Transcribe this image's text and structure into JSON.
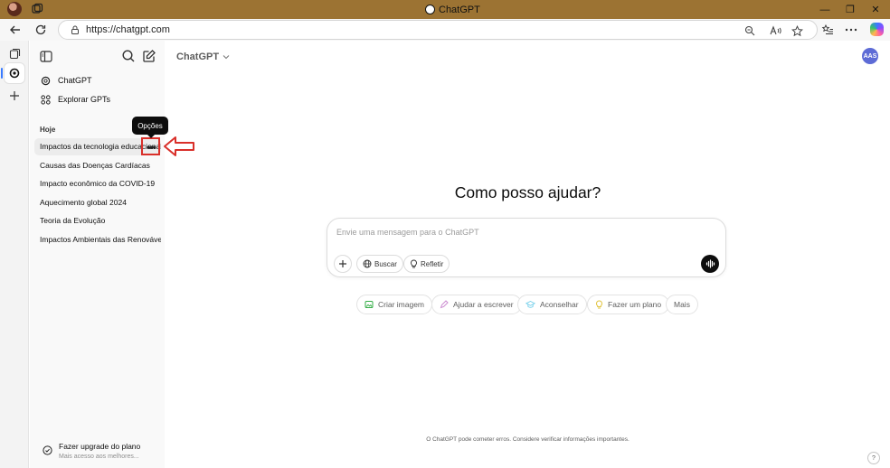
{
  "window": {
    "title": "ChatGPT"
  },
  "browser": {
    "url": "https://chatgpt.com",
    "window_controls": {
      "minimize": "—",
      "restore": "❐",
      "close": "✕"
    }
  },
  "sidebar": {
    "nav": [
      {
        "label": "ChatGPT",
        "icon": "chatgpt-logo-icon"
      },
      {
        "label": "Explorar GPTs",
        "icon": "grid-icon"
      }
    ],
    "section_label": "Hoje",
    "chats": [
      "Impactos da tecnologia educacional",
      "Causas das Doenças Cardíacas",
      "Impacto econômico da COVID-19",
      "Aquecimento global 2024",
      "Teoria da Evolução",
      "Impactos Ambientais das Renováveis"
    ],
    "options_tooltip": "Opções",
    "options_glyph": "•••",
    "upgrade": {
      "title": "Fazer upgrade do plano",
      "subtitle": "Mais acesso aos melhores..."
    }
  },
  "main": {
    "model": "ChatGPT",
    "avatar_initials": "AAS",
    "heading": "Como posso ajudar?",
    "composer": {
      "placeholder": "Envie uma mensagem para o ChatGPT",
      "buttons": {
        "search": "Buscar",
        "reason": "Refletir"
      }
    },
    "suggestions": [
      {
        "label": "Criar imagem",
        "icon": "image-icon",
        "color": "#35ae47"
      },
      {
        "label": "Ajudar a escrever",
        "icon": "pen-icon",
        "color": "#cb8bd0"
      },
      {
        "label": "Aconselhar",
        "icon": "graduation-cap-icon",
        "color": "#76d0eb"
      },
      {
        "label": "Fazer um plano",
        "icon": "lightbulb-icon",
        "color": "#e2c541"
      },
      {
        "label": "Mais",
        "icon": "",
        "color": ""
      }
    ],
    "disclaimer": "O ChatGPT pode cometer erros. Considere verificar informações importantes.",
    "help": "?"
  },
  "colors": {
    "titlebar": "#9c7333",
    "annotation_red": "#d9302a",
    "avatar_bg": "#5d6bd6"
  }
}
